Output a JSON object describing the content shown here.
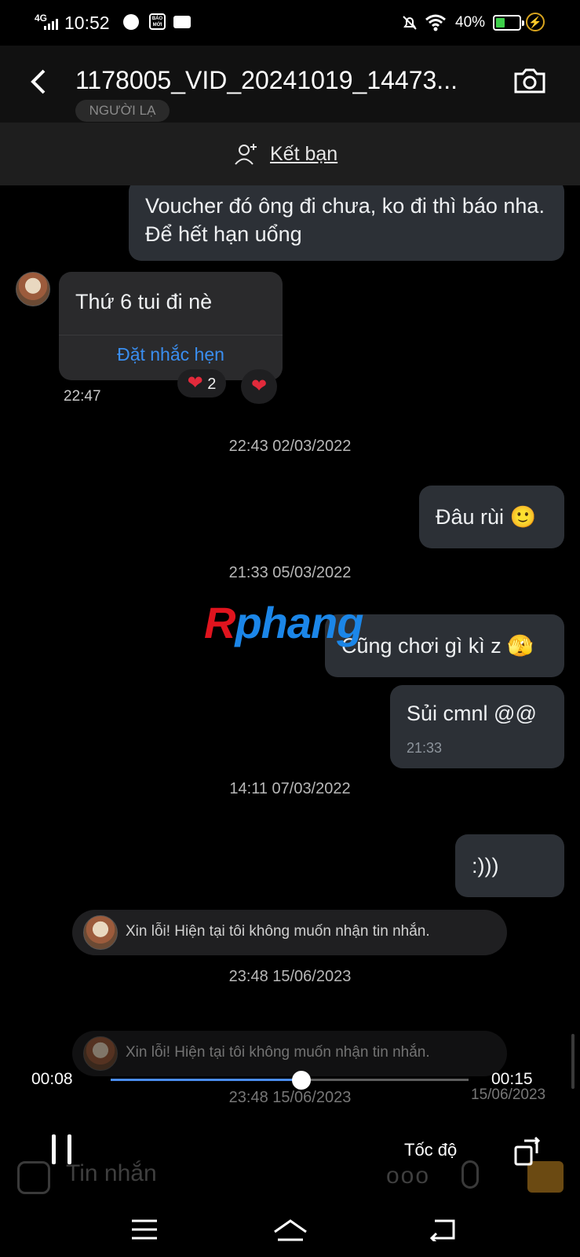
{
  "status_bar": {
    "network": "4G",
    "time": "10:52",
    "baomoi": "BÁO MỚI",
    "battery_percent_text": "40%",
    "battery_level": 0.4,
    "icons": [
      "signal-icon",
      "browser-icon",
      "baomoi-icon",
      "mail-icon",
      "mute-icon",
      "wifi-icon",
      "battery-icon",
      "charging-icon"
    ]
  },
  "player": {
    "title": "1178005_VID_20241019_14473...",
    "ghost_badge": "NGƯỜI LẠ",
    "current_time": "00:08",
    "total_time": "00:15",
    "progress": 0.533,
    "speed_label": "Tốc độ",
    "accent_color": "#4a8df0"
  },
  "chat": {
    "add_friend_label": "Kết bạn",
    "messages": [
      {
        "side": "sent",
        "text": "Voucher đó ông đi chưa, ko đi thì báo nha. Để hết hạn uổng"
      },
      {
        "side": "received",
        "text": "Thứ 6 tui đi nè",
        "action": "Đặt nhắc hẹn",
        "time": "22:47",
        "reaction_count": "2"
      },
      {
        "type": "timestamp",
        "text": "22:43 02/03/2022"
      },
      {
        "side": "sent",
        "text": "Đâu rùi 🙂"
      },
      {
        "type": "timestamp",
        "text": "21:33 05/03/2022"
      },
      {
        "side": "sent",
        "text": "Cũng chơi gì kì z 🫣"
      },
      {
        "side": "sent",
        "text": "Sủi cmnl @@",
        "time": "21:33"
      },
      {
        "type": "timestamp",
        "text": "14:11 07/03/2022"
      },
      {
        "side": "sent",
        "text": ":)))"
      },
      {
        "type": "notice",
        "text": "Xin lỗi! Hiện tại tôi không muốn nhận tin nhắn."
      },
      {
        "type": "timestamp",
        "text": "23:48 15/06/2023"
      },
      {
        "type": "notice",
        "text": "Xin lỗi! Hiện tại tôi không muốn nhận tin nhắn."
      },
      {
        "type": "timestamp",
        "text": "23:48 15/06/2023"
      }
    ],
    "side_date": "15/06/2023",
    "composer_placeholder": "Tin nhắn",
    "composer_more": "ooo"
  },
  "watermark": {
    "r": "R",
    "rest": "phang"
  }
}
